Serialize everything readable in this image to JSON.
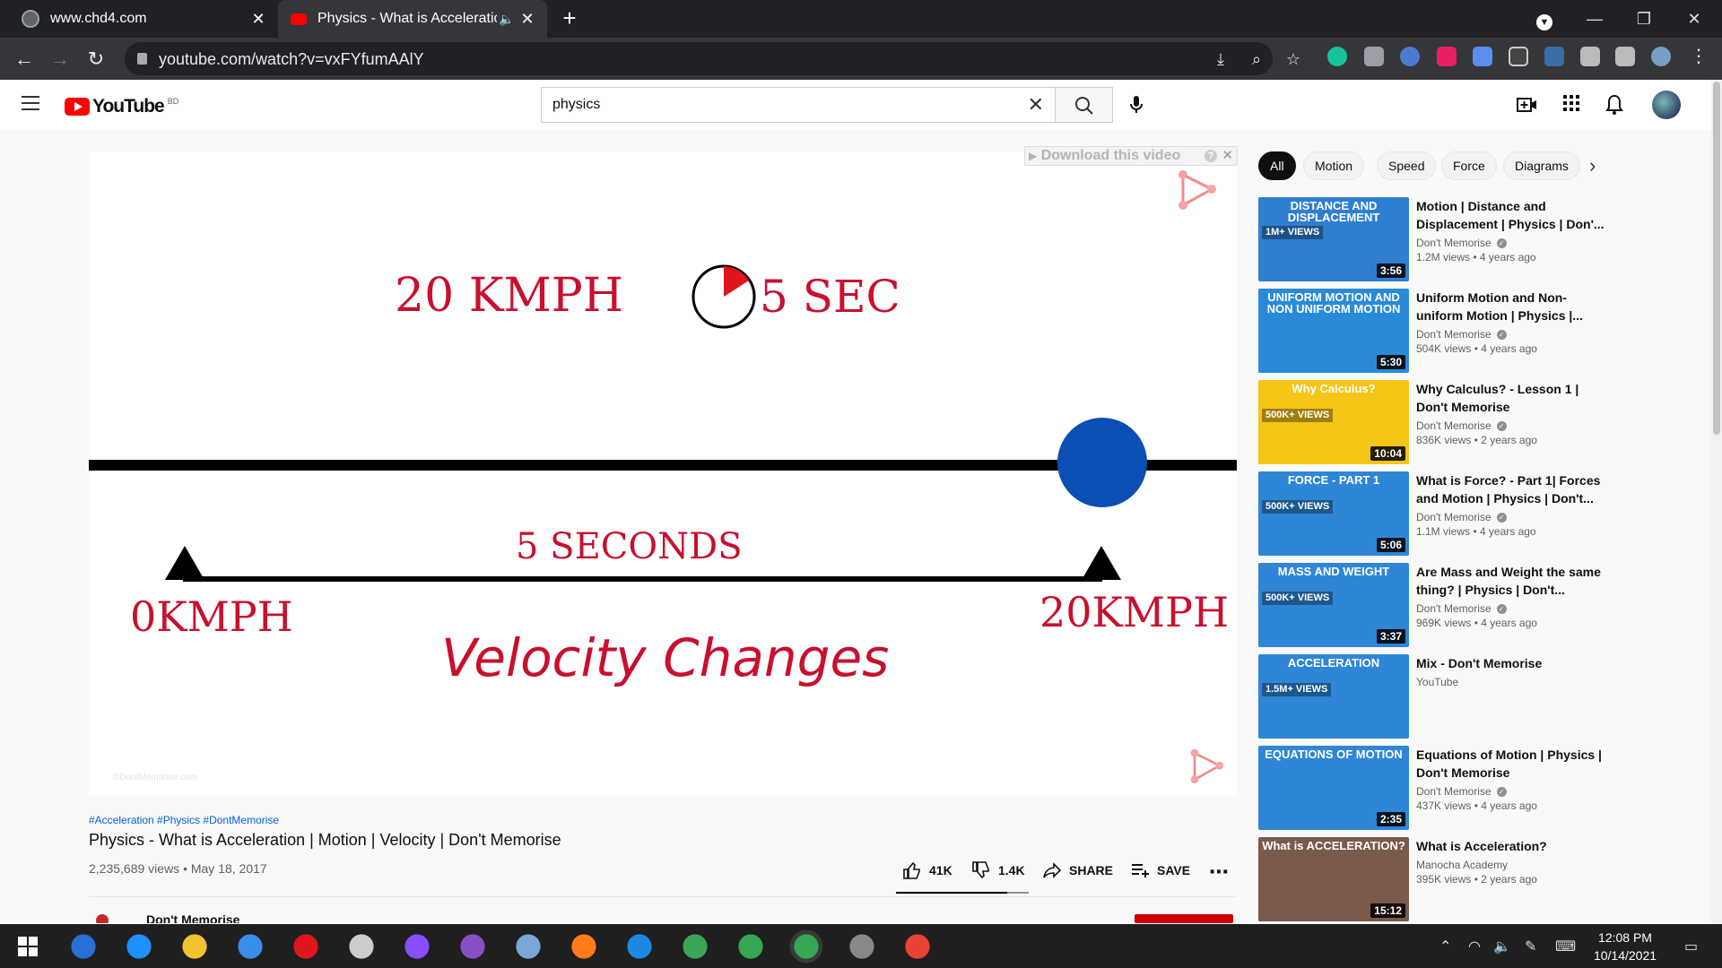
{
  "browser": {
    "tabs": [
      {
        "title": "www.chd4.com",
        "active": false
      },
      {
        "title": "Physics - What is Acceleratio",
        "active": true
      }
    ],
    "url": "youtube.com/watch?v=vxFYfumAAlY"
  },
  "youtube": {
    "logo_text": "YouTube",
    "country": "BD",
    "search_value": "physics"
  },
  "video_frame": {
    "download_bar": "Download this video",
    "download_help": "?",
    "speed_label": "20 KMPH",
    "time_label": "5 SEC",
    "duration_label": "5 SECONDS",
    "start_label": "0KMPH",
    "end_label": "20KMPH",
    "caption": "Velocity Changes",
    "watermark": "©DontMemorise.com"
  },
  "video": {
    "hashtags": "#Acceleration #Physics #DontMemorise",
    "title": "Physics - What is Acceleration | Motion | Velocity | Don't Memorise",
    "meta": "2,235,689 views • May 18, 2017",
    "likes": "41K",
    "dislikes": "1.4K",
    "like_ratio": 0.84,
    "share_label": "SHARE",
    "save_label": "SAVE",
    "channel_partial": "Don't Memorise"
  },
  "chips": [
    "All",
    "Motion",
    "Speed",
    "Force",
    "Diagrams"
  ],
  "recommendations": [
    {
      "thumb_title": "DISTANCE AND DISPLACEMENT",
      "thumb_views": "1M+ VIEWS",
      "thumb_color": "#2f7fd0",
      "duration": "3:56",
      "title": "Motion | Distance and Displacement | Physics | Don'...",
      "channel": "Don't Memorise",
      "verified": true,
      "meta": "1.2M views • 4 years ago"
    },
    {
      "thumb_title": "UNIFORM MOTION AND NON UNIFORM MOTION",
      "thumb_views": "",
      "thumb_color": "#2a8ad8",
      "duration": "5:30",
      "title": "Uniform Motion and Non-uniform Motion | Physics |...",
      "channel": "Don't Memorise",
      "verified": true,
      "meta": "504K views • 4 years ago"
    },
    {
      "thumb_title": "Why Calculus?",
      "thumb_views": "500K+ VIEWS",
      "thumb_color": "#f5c518",
      "duration": "10:04",
      "title": "Why Calculus? - Lesson 1 | Don't Memorise",
      "channel": "Don't Memorise",
      "verified": true,
      "meta": "836K views • 2 years ago"
    },
    {
      "thumb_title": "FORCE - PART 1",
      "thumb_views": "500K+ VIEWS",
      "thumb_color": "#2f86d6",
      "duration": "5:06",
      "title": "What is Force? - Part 1| Forces and Motion | Physics | Don't...",
      "channel": "Don't Memorise",
      "verified": true,
      "meta": "1.1M views • 4 years ago"
    },
    {
      "thumb_title": "MASS AND WEIGHT",
      "thumb_views": "500K+ VIEWS",
      "thumb_color": "#2f86d6",
      "duration": "3:37",
      "title": "Are Mass and Weight the same thing? | Physics | Don't...",
      "channel": "Don't Memorise",
      "verified": true,
      "meta": "969K views • 4 years ago"
    },
    {
      "thumb_title": "ACCELERATION",
      "thumb_views": "1.5M+ VIEWS",
      "thumb_color": "#2f86d6",
      "duration": "",
      "title": "Mix - Don't Memorise",
      "channel": "YouTube",
      "verified": false,
      "meta": ""
    },
    {
      "thumb_title": "EQUATIONS OF MOTION",
      "thumb_views": "",
      "thumb_color": "#2f86d6",
      "duration": "2:35",
      "title": "Equations of Motion | Physics | Don't Memorise",
      "channel": "Don't Memorise",
      "verified": true,
      "meta": "437K views • 4 years ago"
    },
    {
      "thumb_title": "What is ACCELERATION?",
      "thumb_views": "",
      "thumb_color": "#7a5a4a",
      "duration": "15:12",
      "title": "What is Acceleration?",
      "channel": "Manocha Academy",
      "verified": false,
      "meta": "395K views • 2 years ago"
    }
  ],
  "taskbar": {
    "time": "12:08 PM",
    "date": "10/14/2021",
    "apps": [
      {
        "name": "start",
        "color": "#ffffff"
      },
      {
        "name": "qb",
        "color": "#2a6fd6"
      },
      {
        "name": "edge",
        "color": "#1e90ff"
      },
      {
        "name": "explorer",
        "color": "#f2c230"
      },
      {
        "name": "mail",
        "color": "#3b8ee8"
      },
      {
        "name": "opera",
        "color": "#e0161e"
      },
      {
        "name": "satellite",
        "color": "#cccccc"
      },
      {
        "name": "messenger",
        "color": "#8a4dff"
      },
      {
        "name": "github",
        "color": "#8a4dc8"
      },
      {
        "name": "paint",
        "color": "#7aa7d8"
      },
      {
        "name": "firefox",
        "color": "#ff7b1c"
      },
      {
        "name": "vscode",
        "color": "#1e88e5"
      },
      {
        "name": "globe",
        "color": "#3aa655"
      },
      {
        "name": "chrome",
        "color": "#34a853"
      },
      {
        "name": "chrome-active",
        "color": "#34a853"
      },
      {
        "name": "terminal",
        "color": "#888888"
      },
      {
        "name": "chrome-2",
        "color": "#ea4335"
      }
    ]
  }
}
